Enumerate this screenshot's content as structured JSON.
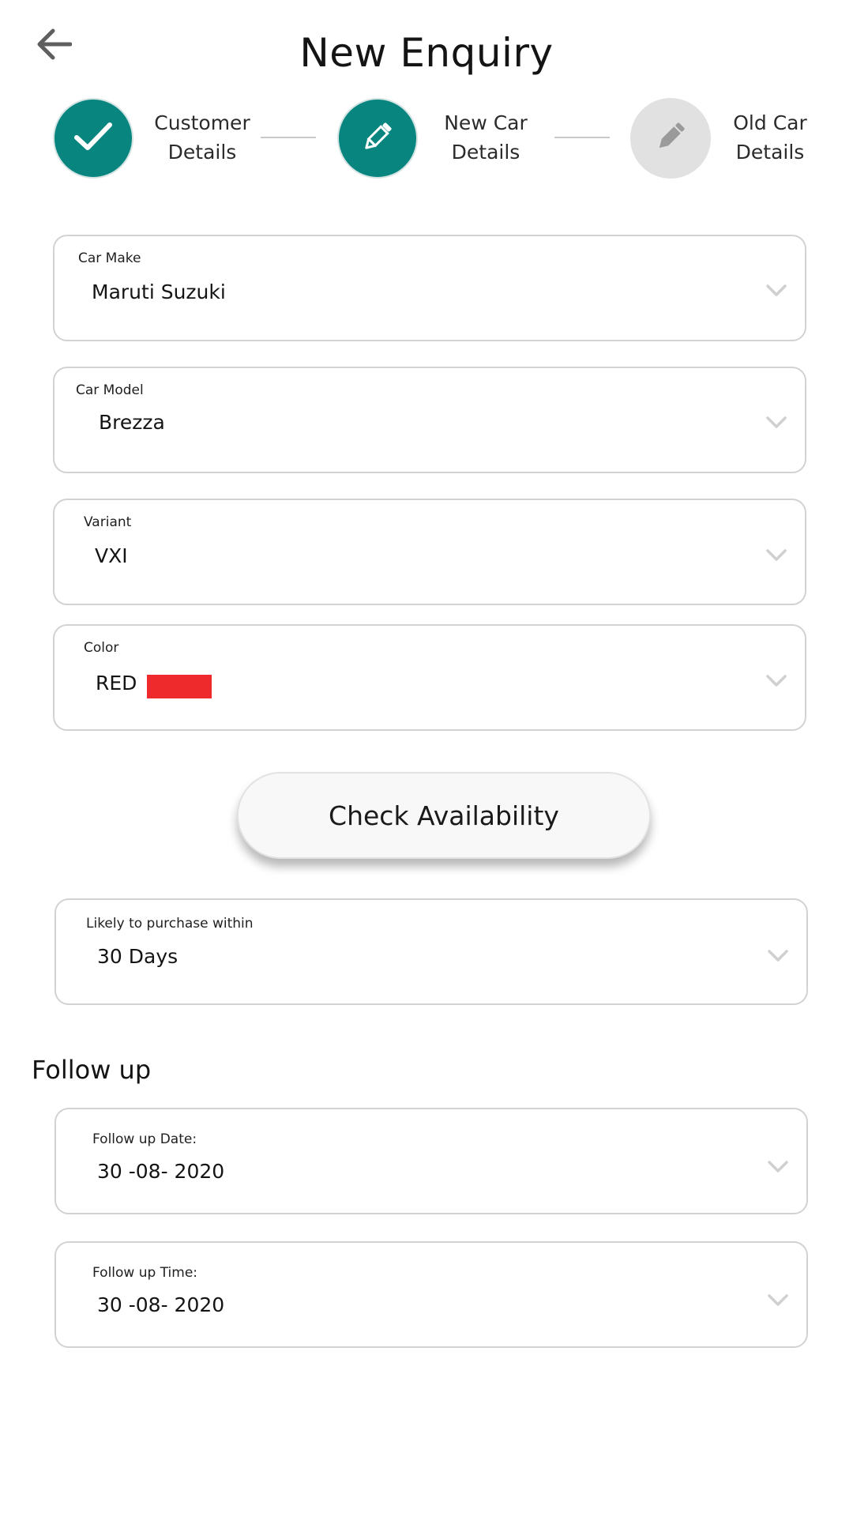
{
  "header": {
    "title": "New Enquiry",
    "back_icon": "arrow-left-icon"
  },
  "stepper": {
    "steps": [
      {
        "line1": "Customer",
        "line2": "Details",
        "state": "completed",
        "icon": "check-icon"
      },
      {
        "line1": "New Car",
        "line2": "Details",
        "state": "active",
        "icon": "pencil-icon"
      },
      {
        "line1": "Old Car",
        "line2": "Details",
        "state": "pending",
        "icon": "pencil-icon"
      }
    ]
  },
  "form": {
    "car_make": {
      "label": "Car Make",
      "value": "Maruti Suzuki"
    },
    "car_model": {
      "label": "Car Model",
      "value": "Brezza"
    },
    "variant": {
      "label": "Variant",
      "value": "VXI"
    },
    "color": {
      "label": "Color",
      "value": "RED",
      "swatch": "#ef2a2d"
    },
    "check_availability": "Check Availability",
    "purchase_within": {
      "label": "Likely to purchase within",
      "value": "30 Days"
    }
  },
  "follow_up": {
    "title": "Follow up",
    "date": {
      "label": "Follow up Date:",
      "value": "30 -08- 2020"
    },
    "time": {
      "label": "Follow up Time:",
      "value": "30 -08- 2020"
    }
  },
  "colors": {
    "accent": "#098580",
    "pending_step": "#e1e1e1",
    "field_border": "#d2d2d2",
    "chevron": "#d0d0d0"
  }
}
